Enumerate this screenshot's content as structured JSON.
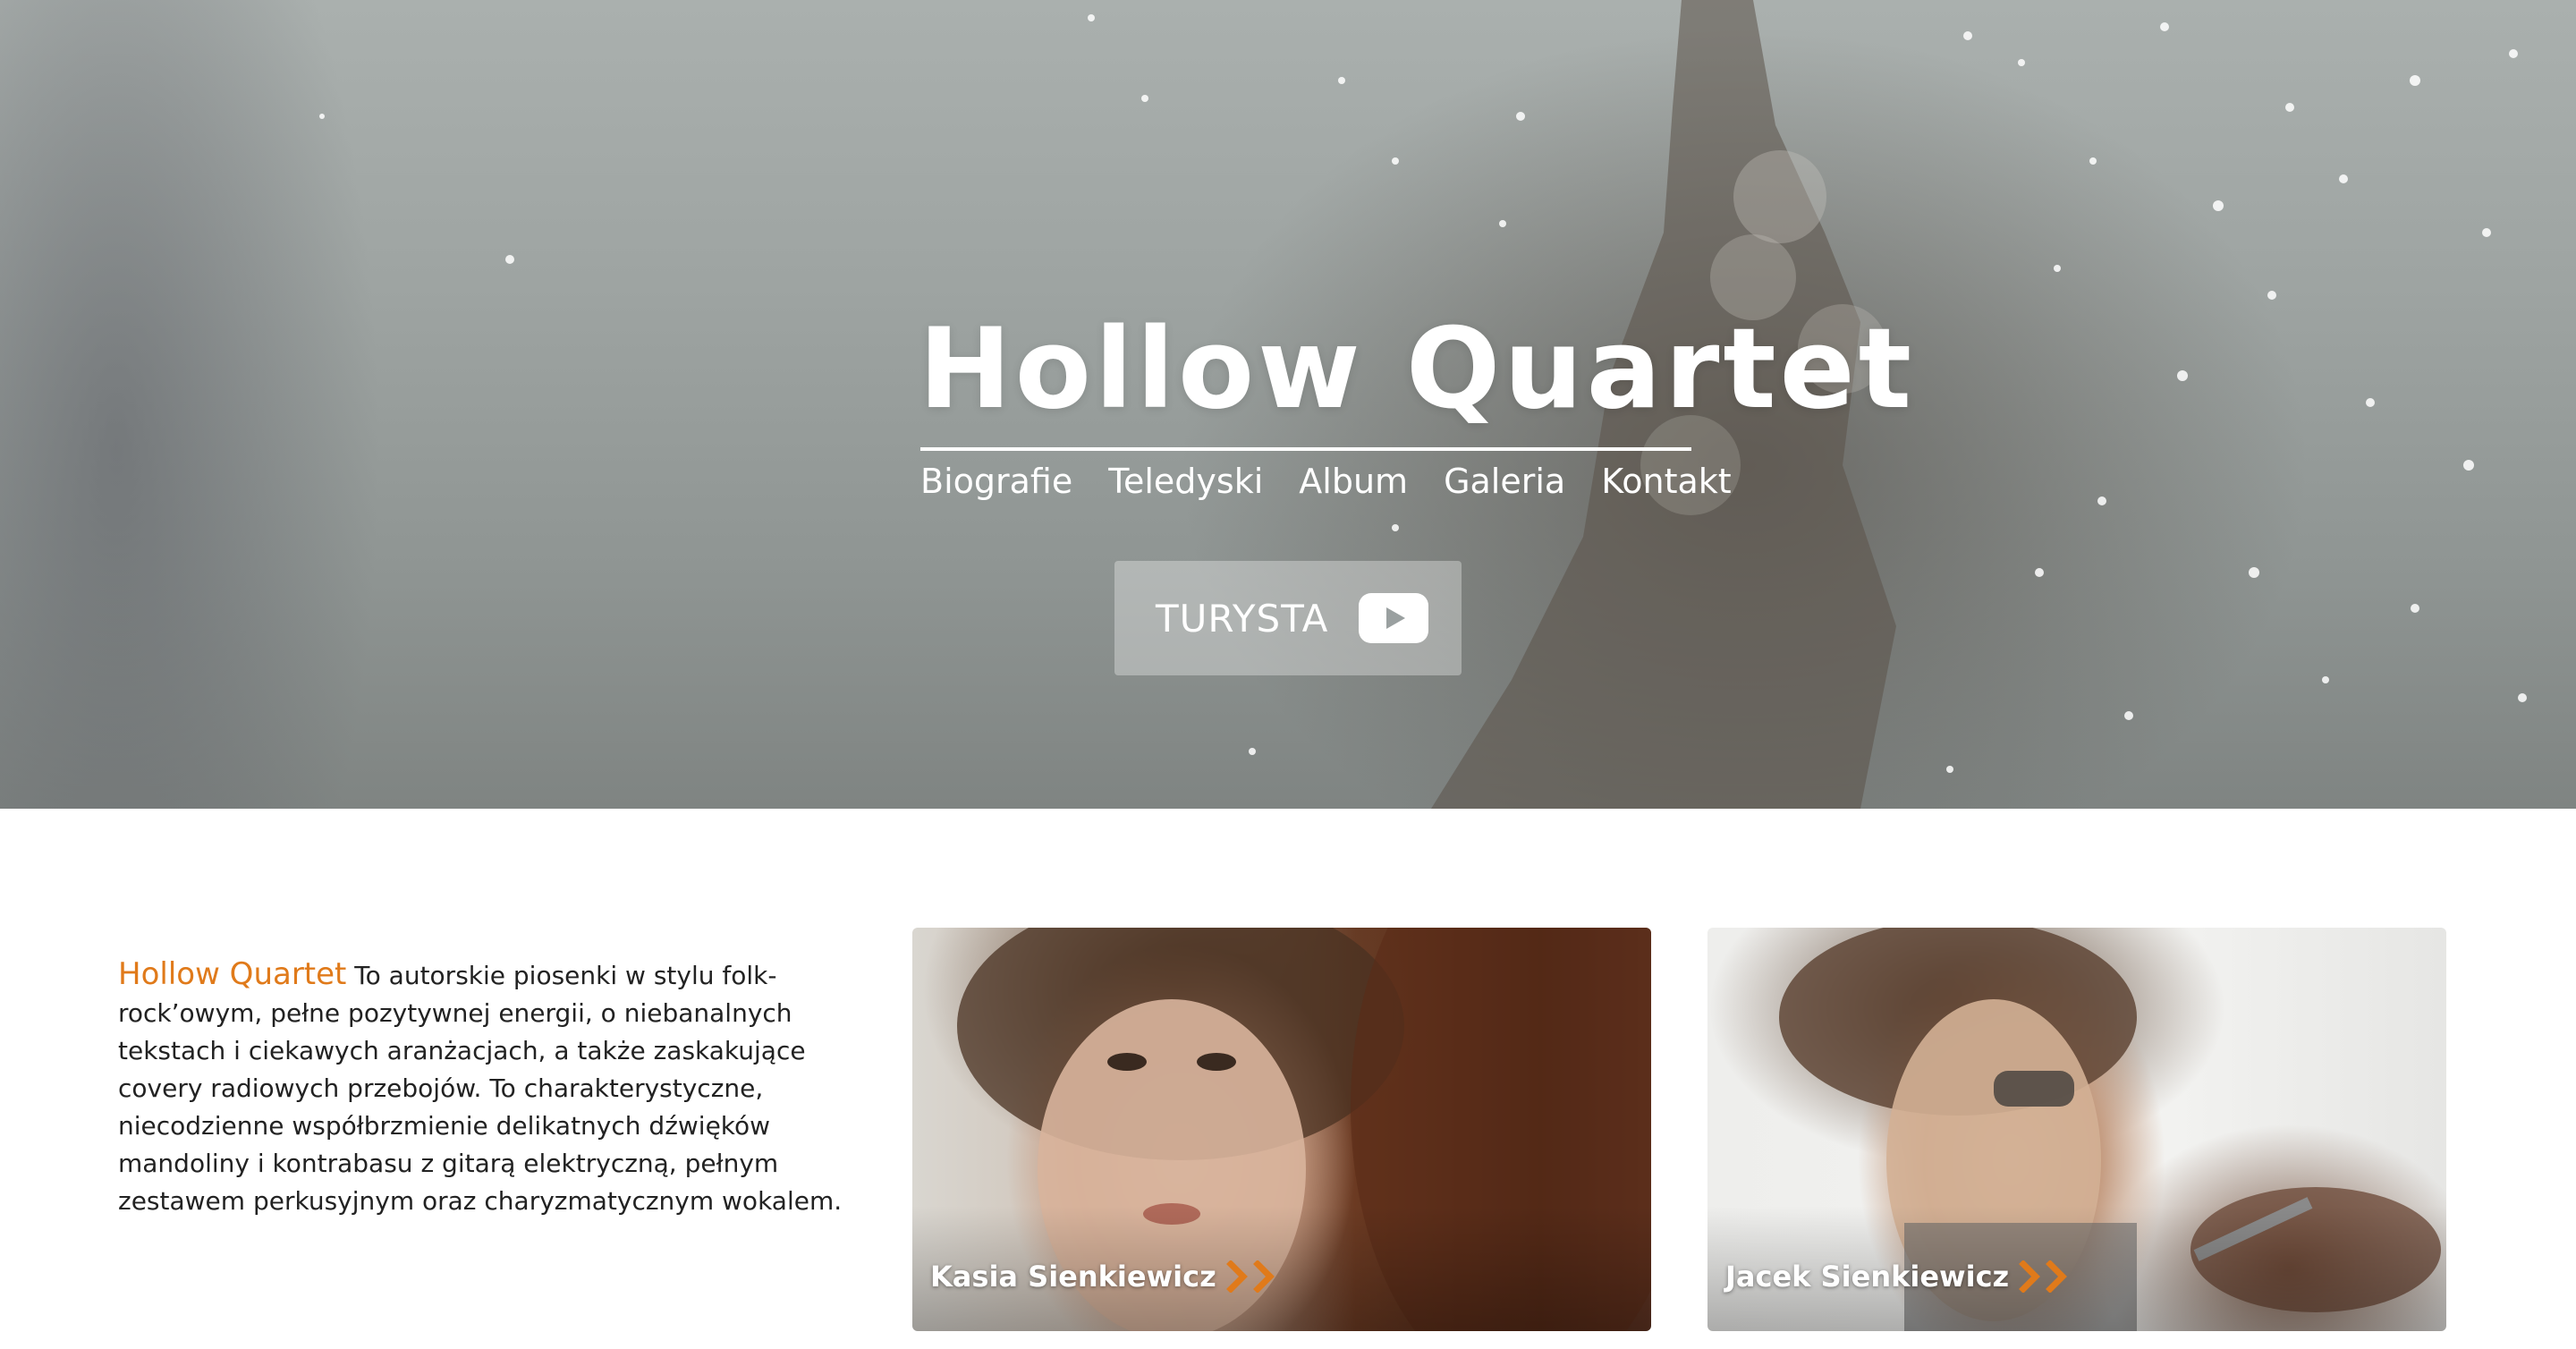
{
  "hero": {
    "title": "Hollow Quartet",
    "nav": [
      "Biografie",
      "Teledyski",
      "Album",
      "Galeria",
      "Kontakt"
    ],
    "video_button": {
      "label": "TURYSTA",
      "icon": "youtube-play-icon"
    }
  },
  "intro": {
    "brand": "Hollow Quartet",
    "text": " To autorskie piosenki w stylu folk-rock’owym, pełne pozytywnej energii, o niebanalnych tekstach i ciekawych aranżacjach, a także zaskakujące covery radiowych przebojów. To charakterystyczne, niecodzienne współbrzmienie delikatnych dźwięków mandoliny i kontrabasu z gitarą elektryczną, pełnym zestawem perkusyjnym oraz charyzmatycznym wokalem."
  },
  "members": [
    {
      "name": "Kasia Sienkiewicz",
      "icon": "double-chevron-right-icon"
    },
    {
      "name": "Jacek Sienkiewicz",
      "icon": "double-chevron-right-icon"
    }
  ],
  "colors": {
    "accent": "#e07a1a",
    "text": "#222222",
    "white": "#ffffff"
  }
}
